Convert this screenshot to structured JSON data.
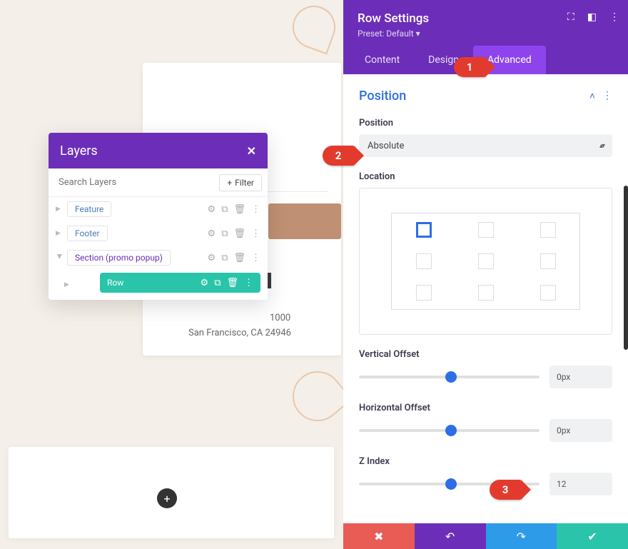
{
  "bg": {
    "addr1": "1000",
    "addr2": "San Francisco, CA 24946"
  },
  "layers": {
    "title": "Layers",
    "search_placeholder": "Search Layers",
    "filter_label": "Filter",
    "items": [
      {
        "label": "Feature"
      },
      {
        "label": "Footer"
      },
      {
        "label": "Section (promo popup)"
      }
    ],
    "row_label": "Row"
  },
  "panel": {
    "title": "Row Settings",
    "preset": "Preset: Default",
    "tabs": [
      "Content",
      "Design",
      "Advanced"
    ],
    "section_title": "Position",
    "position_label": "Position",
    "position_value": "Absolute",
    "location_label": "Location",
    "voffset_label": "Vertical Offset",
    "voffset_value": "0px",
    "hoffset_label": "Horizontal Offset",
    "hoffset_value": "0px",
    "zindex_label": "Z Index",
    "zindex_value": "12"
  },
  "callouts": [
    "1",
    "2",
    "3"
  ]
}
